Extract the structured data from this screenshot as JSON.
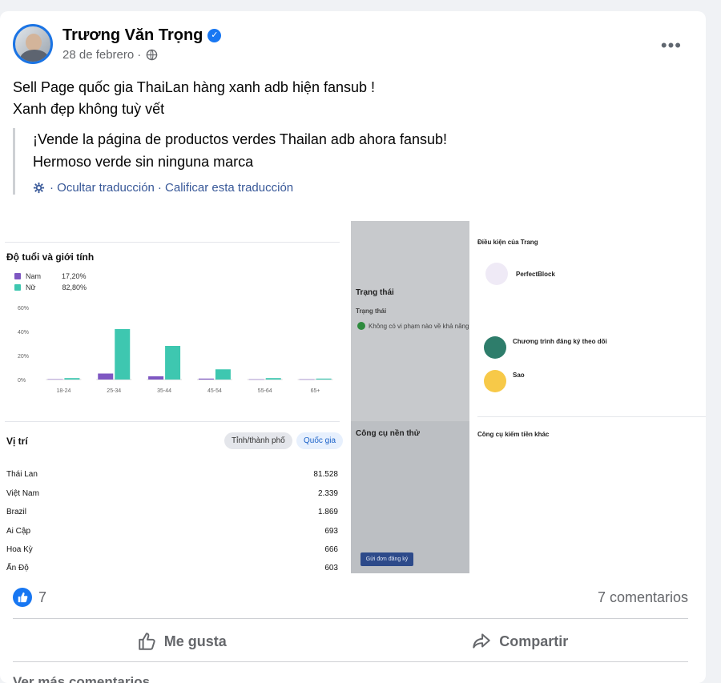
{
  "post": {
    "author": "Trương Văn Trọng",
    "verified_icon": "verified-badge-icon",
    "date": "28 de febrero",
    "dot": "·",
    "menu_label": "•••",
    "text_lines": [
      "Sell Page quốc gia ThaiLan hàng xanh adb hiện fansub !",
      "Xanh đẹp không tuỳ vết"
    ],
    "translation_lines": [
      "¡Vende la página de productos verdes Thailan adb ahora fansub!",
      "Hermoso verde sin ninguna marca"
    ],
    "translation_links": {
      "hide": "· Ocultar traducción",
      "rate": "· Calificar esta traducción"
    }
  },
  "screenshot_left": {
    "age_gender_title": "Độ tuổi và giới tính",
    "legend": [
      {
        "label": "Nam",
        "pct": "17,20%",
        "color": "#7e57c2"
      },
      {
        "label": "Nữ",
        "pct": "82,80%",
        "color": "#3ec7b0"
      }
    ],
    "location_title": "Vị trí",
    "tabs": [
      "Tỉnh/thành phố",
      "Quốc gia"
    ],
    "locations": [
      {
        "name": "Thái Lan",
        "value": "81.528"
      },
      {
        "name": "Việt Nam",
        "value": "2.339"
      },
      {
        "name": "Brazil",
        "value": "1.869"
      },
      {
        "name": "Ai Cập",
        "value": "693"
      },
      {
        "name": "Hoa Kỳ",
        "value": "666"
      },
      {
        "name": "Ấn Độ",
        "value": "603"
      }
    ]
  },
  "chart_data": {
    "type": "bar",
    "categories": [
      "18-24",
      "25-34",
      "35-44",
      "45-54",
      "55-64",
      "65+"
    ],
    "series": [
      {
        "name": "Nam",
        "values": [
          0.3,
          5,
          2.7,
          0.8,
          0.2,
          0.2
        ]
      },
      {
        "name": "Nữ",
        "values": [
          1.2,
          42,
          28,
          8.5,
          1.2,
          0.8
        ]
      }
    ],
    "yticks": [
      "60%",
      "40%",
      "20%",
      "0%"
    ],
    "ylim": [
      0,
      60
    ]
  },
  "screenshot_mid": {
    "status_title": "Trạng thái",
    "status_label": "Trạng thái",
    "status_text": "Không có vi phạm nào về khả năng",
    "tools_title": "Công cụ nền thử",
    "button_text": "Gửi đơn đăng ký"
  },
  "screenshot_right": {
    "conditions_title": "Điều kiện của Trang",
    "product": "PerfectBlock",
    "program_title": "Chương trình đăng ký theo dõi",
    "stars_title": "Sao",
    "tools_title": "Công cụ kiếm tiền khác"
  },
  "footer": {
    "like_count": "7",
    "comments": "7 comentarios",
    "like_label": "Me gusta",
    "share_label": "Compartir",
    "more_comments": "Ver más comentarios"
  }
}
